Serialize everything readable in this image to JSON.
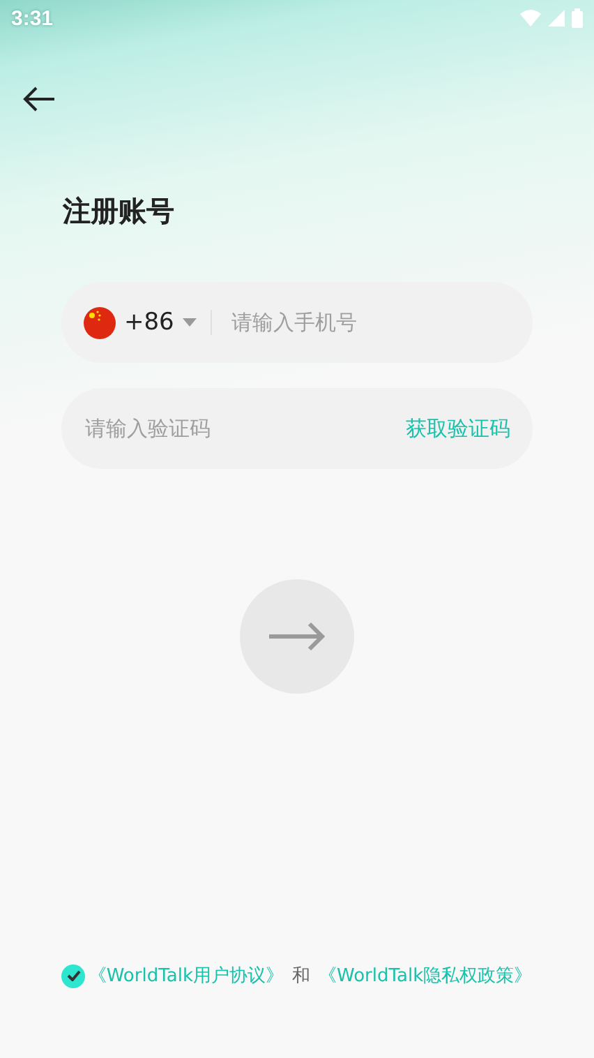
{
  "status_bar": {
    "time": "3:31"
  },
  "title": "注册账号",
  "phone_field": {
    "country_code": "+86",
    "placeholder": "请输入手机号"
  },
  "code_field": {
    "placeholder": "请输入验证码",
    "action": "获取验证码"
  },
  "next_button": {
    "disabled": true
  },
  "agreement": {
    "checked": true,
    "links": [
      "《WorldTalk用户协议》",
      "《WorldTalk隐私权政策》"
    ],
    "joiner": "和"
  }
}
